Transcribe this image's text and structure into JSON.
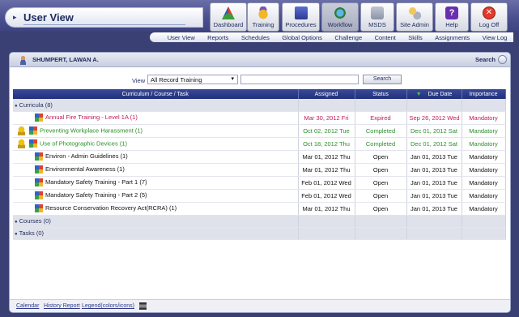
{
  "header": {
    "title": "User View",
    "tools": [
      {
        "label": "Dashboard",
        "icon": "dashboard-icon"
      },
      {
        "label": "Training",
        "icon": "training-icon"
      },
      {
        "label": "Procedures",
        "icon": "procedures-icon"
      },
      {
        "label": "Workflow",
        "icon": "workflow-icon"
      },
      {
        "label": "MSDS",
        "icon": "msds-icon"
      },
      {
        "label": "Site Admin",
        "icon": "site-admin-icon"
      },
      {
        "label": "Help",
        "icon": "help-icon"
      },
      {
        "label": "Log Off",
        "icon": "log-off-icon"
      }
    ],
    "menu": [
      "User View",
      "Reports",
      "Schedules",
      "Global Options",
      "Challenge",
      "Content",
      "Skills",
      "Assignments",
      "View Log"
    ]
  },
  "panel": {
    "user_name": "SHUMPERT, LAWAN A.",
    "search_label": "Search",
    "view_label": "View",
    "view_value": "All Record Training",
    "search_value": "",
    "search_button": "Search"
  },
  "table": {
    "columns": [
      "Curriculum / Course / Task",
      "Assigned",
      "Status",
      "Due Date",
      "Importance"
    ],
    "groups": {
      "curricula": "Curricula",
      "curricula_count": "(8)",
      "courses": "Courses",
      "courses_count": "(0)",
      "tasks": "Tasks",
      "tasks_count": "(0)"
    },
    "rows": [
      {
        "name": "Annual Fire Training - Level 1A",
        "count": "(1)",
        "assigned": "Mar 30, 2012 Fri",
        "status": "Expired",
        "due": "Sep 26, 2012 Wed",
        "importance": "Mandatory",
        "tone": "red",
        "award": false
      },
      {
        "name": "Preventing Workplace Harassment",
        "count": "(1)",
        "assigned": "Oct 02, 2012 Tue",
        "status": "Completed",
        "due": "Dec 01, 2012 Sat",
        "importance": "Mandatory",
        "tone": "green",
        "award": true
      },
      {
        "name": "Use of Photographic Devices",
        "count": "(1)",
        "assigned": "Oct 18, 2012 Thu",
        "status": "Completed",
        "due": "Dec 01, 2012 Sat",
        "importance": "Mandatory",
        "tone": "green",
        "award": true
      },
      {
        "name": "Environ - Admin Guidelines",
        "count": "(1)",
        "assigned": "Mar 01, 2012 Thu",
        "status": "Open",
        "due": "Jan 01, 2013 Tue",
        "importance": "Mandatory",
        "tone": "dark",
        "award": false
      },
      {
        "name": "Environmental Awareness",
        "count": "(1)",
        "assigned": "Mar 01, 2012 Thu",
        "status": "Open",
        "due": "Jan 01, 2013 Tue",
        "importance": "Mandatory",
        "tone": "dark",
        "award": false
      },
      {
        "name": "Mandatory Safety Training - Part 1",
        "count": "(7)",
        "assigned": "Feb 01, 2012 Wed",
        "status": "Open",
        "due": "Jan 01, 2013 Tue",
        "importance": "Mandatory",
        "tone": "dark",
        "award": false
      },
      {
        "name": "Mandatory Safety Training - Part 2",
        "count": "(5)",
        "assigned": "Feb 01, 2012 Wed",
        "status": "Open",
        "due": "Jan 01, 2013 Tue",
        "importance": "Mandatory",
        "tone": "dark",
        "award": false
      },
      {
        "name": "Resource Conservation Recovery Act(RCRA)",
        "count": "(1)",
        "assigned": "Mar 01, 2012 Thu",
        "status": "Open",
        "due": "Jan 01, 2013 Tue",
        "importance": "Mandatory",
        "tone": "dark",
        "award": false
      }
    ]
  },
  "footer": {
    "links": [
      "Calendar",
      "History Report",
      "Legend(colors/icons)"
    ]
  }
}
